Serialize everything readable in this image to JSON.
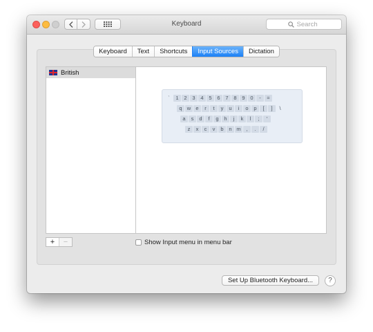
{
  "window": {
    "title": "Keyboard"
  },
  "toolbar": {
    "search_placeholder": "Search"
  },
  "tabs": [
    {
      "label": "Keyboard",
      "active": false
    },
    {
      "label": "Text",
      "active": false
    },
    {
      "label": "Shortcuts",
      "active": false
    },
    {
      "label": "Input Sources",
      "active": true
    },
    {
      "label": "Dictation",
      "active": false
    }
  ],
  "sources": [
    {
      "label": "British",
      "icon": "uk-flag-icon",
      "selected": true
    }
  ],
  "keyboard_preview": {
    "rows": [
      [
        "`",
        "1",
        "2",
        "3",
        "4",
        "5",
        "6",
        "7",
        "8",
        "9",
        "0",
        "-",
        "="
      ],
      [
        "q",
        "w",
        "e",
        "r",
        "t",
        "y",
        "u",
        "i",
        "o",
        "p",
        "[",
        "]",
        "\\"
      ],
      [
        "a",
        "s",
        "d",
        "f",
        "g",
        "h",
        "j",
        "k",
        "l",
        ";",
        "'"
      ],
      [
        "z",
        "x",
        "c",
        "v",
        "b",
        "n",
        "m",
        ",",
        ".",
        "/"
      ]
    ]
  },
  "list_controls": {
    "add": "+",
    "remove": "−"
  },
  "show_input_menu": {
    "label": "Show Input menu in menu bar",
    "checked": false
  },
  "bluetooth_button": {
    "label": "Set Up Bluetooth Keyboard..."
  },
  "help_button": {
    "label": "?"
  },
  "colors": {
    "accent": "#1b80f6",
    "close": "#fc605c",
    "minimize": "#fdbc40",
    "zoom_disabled": "#cfcfcf"
  }
}
